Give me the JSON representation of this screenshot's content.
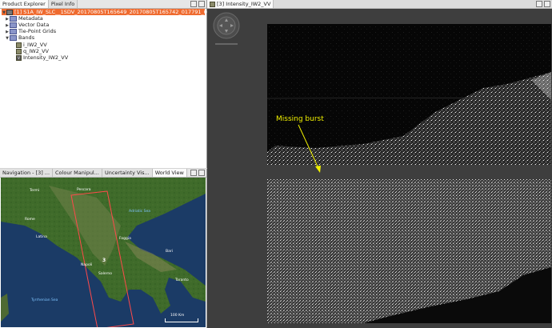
{
  "product_panel": {
    "tabs": [
      "Product Explorer",
      "Pixel Info"
    ],
    "product_name": "[1] S1A_IW_SLC__1SDV_20170805T165649_20170805T165742_017791_01DCFD_E",
    "groups": [
      "Metadata",
      "Vector Data",
      "Tie-Point Grids",
      "Bands"
    ],
    "bands": [
      "i_IW2_VV",
      "q_IW2_VV",
      "Intensity_IW2_VV"
    ]
  },
  "nav_panel": {
    "tabs": [
      "Navigation - [3] ...",
      "Colour Manipul...",
      "Uncertainty Vis...",
      "World View"
    ],
    "overlay_label": "3",
    "scale_label": "100 Km",
    "places": [
      {
        "name": "Termi",
        "kind": "land"
      },
      {
        "name": "Pescara",
        "kind": "land"
      },
      {
        "name": "Adriatic Sea",
        "kind": "sea"
      },
      {
        "name": "Rome",
        "kind": "land"
      },
      {
        "name": "Latina",
        "kind": "land"
      },
      {
        "name": "Foggia",
        "kind": "land"
      },
      {
        "name": "Bari",
        "kind": "land"
      },
      {
        "name": "Napoli",
        "kind": "land"
      },
      {
        "name": "Salerno",
        "kind": "land"
      },
      {
        "name": "Taranto",
        "kind": "land"
      },
      {
        "name": "Tyrrhenian Sea",
        "kind": "sea"
      }
    ]
  },
  "image_window": {
    "tab": "[3] Intensity_IW2_VV",
    "annotation": "Missing burst",
    "annotation_color": "#f2f200"
  }
}
